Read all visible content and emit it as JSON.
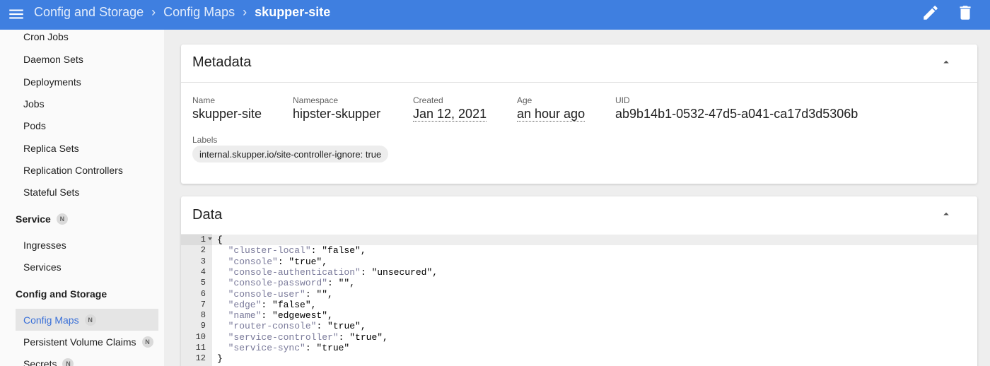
{
  "toolbar": {
    "breadcrumbs": [
      "Config and Storage",
      "Config Maps",
      "skupper-site"
    ],
    "menu_icon": "hamburger-menu-icon",
    "edit_icon": "pencil-icon",
    "delete_icon": "trash-icon",
    "color": "#3f7fe0"
  },
  "sidebar": {
    "workloads": [
      "Cron Jobs",
      "Daemon Sets",
      "Deployments",
      "Jobs",
      "Pods",
      "Replica Sets",
      "Replication Controllers",
      "Stateful Sets"
    ],
    "service_header": "Service",
    "service_items": [
      "Ingresses",
      "Services"
    ],
    "config_header": "Config and Storage",
    "config_items": [
      "Config Maps",
      "Persistent Volume Claims",
      "Secrets"
    ],
    "badge": "N",
    "selected": "Config Maps",
    "selected_color": "#3a70d8"
  },
  "metadata": {
    "title": "Metadata",
    "name_label": "Name",
    "name": "skupper-site",
    "namespace_label": "Namespace",
    "namespace": "hipster-skupper",
    "created_label": "Created",
    "created": "Jan 12, 2021",
    "age_label": "Age",
    "age": "an hour ago",
    "uid_label": "UID",
    "uid": "ab9b14b1-0532-47d5-a041-ca17d3d5306b",
    "labels_label": "Labels",
    "labels": [
      "internal.skupper.io/site-controller-ignore: true"
    ]
  },
  "data_card": {
    "title": "Data",
    "lines": [
      {
        "n": "1",
        "key": "",
        "rest": "{"
      },
      {
        "n": "2",
        "key": "  \"cluster-local\"",
        "rest": ": \"false\","
      },
      {
        "n": "3",
        "key": "  \"console\"",
        "rest": ": \"true\","
      },
      {
        "n": "4",
        "key": "  \"console-authentication\"",
        "rest": ": \"unsecured\","
      },
      {
        "n": "5",
        "key": "  \"console-password\"",
        "rest": ": \"\","
      },
      {
        "n": "6",
        "key": "  \"console-user\"",
        "rest": ": \"\","
      },
      {
        "n": "7",
        "key": "  \"edge\"",
        "rest": ": \"false\","
      },
      {
        "n": "8",
        "key": "  \"name\"",
        "rest": ": \"edgewest\","
      },
      {
        "n": "9",
        "key": "  \"router-console\"",
        "rest": ": \"true\","
      },
      {
        "n": "10",
        "key": "  \"service-controller\"",
        "rest": ": \"true\","
      },
      {
        "n": "11",
        "key": "  \"service-sync\"",
        "rest": ": \"true\""
      },
      {
        "n": "12",
        "key": "",
        "rest": "}"
      }
    ]
  }
}
